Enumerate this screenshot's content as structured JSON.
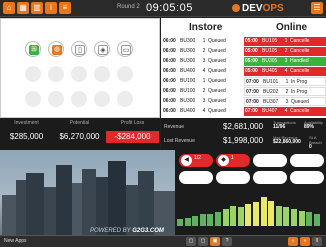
{
  "topbar": {
    "round": "Round 2",
    "clock": "09:05:05",
    "logo_a": "DEV",
    "logo_b": "OPS",
    "buttons": [
      "home-icon",
      "grid-icon",
      "chart-icon",
      "info-icon",
      "list-icon"
    ]
  },
  "colors": {
    "accent": "#e8761d",
    "red": "#e02a2a",
    "green": "#3db13d",
    "dark": "#1b1b1b"
  },
  "instore": {
    "title": "Instore",
    "rows": [
      {
        "time": "06:00",
        "bu": "BU300",
        "n": "1",
        "status": "Queued"
      },
      {
        "time": "06:00",
        "bu": "BU300",
        "n": "2",
        "status": "Queued"
      },
      {
        "time": "06:00",
        "bu": "BU300",
        "n": "3",
        "status": "Queued"
      },
      {
        "time": "06:00",
        "bu": "BU400",
        "n": "4",
        "status": "Queued"
      },
      {
        "time": "06:00",
        "bu": "BU100",
        "n": "1",
        "status": "Queued"
      },
      {
        "time": "06:00",
        "bu": "BU100",
        "n": "2",
        "status": "Queued"
      },
      {
        "time": "06:00",
        "bu": "BU300",
        "n": "3",
        "status": "Queued"
      },
      {
        "time": "06:00",
        "bu": "BU400",
        "n": "4",
        "status": "Queued"
      }
    ]
  },
  "online": {
    "title": "Online",
    "rows": [
      {
        "time": "05:00",
        "bu": "BU105",
        "n": "1",
        "status": "Cancelle",
        "kind": "red"
      },
      {
        "time": "05:00",
        "bu": "BU105",
        "n": "2",
        "status": "Cancelle",
        "kind": "red"
      },
      {
        "time": "05:00",
        "bu": "BU305",
        "n": "3",
        "status": "Handled",
        "kind": "green"
      },
      {
        "time": "05:00",
        "bu": "BU405",
        "n": "4",
        "status": "Cancelle",
        "kind": "red"
      },
      {
        "time": "07:00",
        "bu": "BU101",
        "n": "1",
        "status": "In Prog",
        "kind": "white"
      },
      {
        "time": "07:00",
        "bu": "BU202",
        "n": "2",
        "status": "In Prog",
        "kind": "white"
      },
      {
        "time": "07:00",
        "bu": "BU307",
        "n": "3",
        "status": "Queued",
        "kind": "white"
      },
      {
        "time": "07:00",
        "bu": "BU407",
        "n": "4",
        "status": "Cancelle",
        "kind": "red"
      }
    ]
  },
  "finance": {
    "investment_label": "Investment",
    "investment": "$285,000",
    "potential_label": "Potential",
    "potential": "$6,270,000",
    "profit_label": "Profit Loss",
    "profit": "-$284,000"
  },
  "revenue": {
    "revenue_label": "Revenue",
    "revenue": "$2,681,000",
    "lost_label": "Lost Revenue",
    "lost": "$1,998,000",
    "transactions_label": "Transactions",
    "transactions": "11/96",
    "availability_label": "Availability",
    "availability": "89%",
    "max_revenue_label": "Max Revenue",
    "max_revenue": "$22,860,000",
    "sla_label": "SLA Breach",
    "sla": "0"
  },
  "slots": [
    {
      "icon": "megaphone-icon",
      "count": "1/2",
      "on": true
    },
    {
      "icon": "tag-icon",
      "count": "1",
      "on": true
    },
    {
      "icon": "",
      "count": "",
      "on": false
    },
    {
      "icon": "",
      "count": "",
      "on": false
    },
    {
      "icon": "",
      "count": "",
      "on": false
    },
    {
      "icon": "",
      "count": "",
      "on": false
    },
    {
      "icon": "",
      "count": "",
      "on": false
    },
    {
      "icon": "",
      "count": "",
      "on": false
    }
  ],
  "brand": {
    "prefix": "POWERED BY",
    "name": "G2G3.COM"
  },
  "taskbar": {
    "left": "New Apps"
  }
}
